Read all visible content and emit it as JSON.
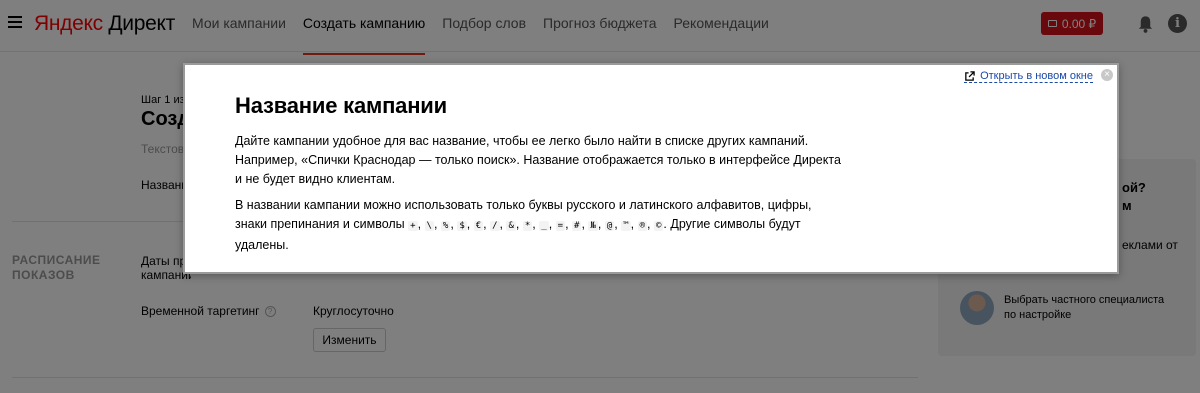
{
  "header": {
    "logo_brand": "Яндекс",
    "logo_product": "Директ",
    "nav": [
      {
        "label": "Мои кампании"
      },
      {
        "label": "Создать кампанию"
      },
      {
        "label": "Подбор слов"
      },
      {
        "label": "Прогноз бюджета"
      },
      {
        "label": "Рекомендации"
      }
    ],
    "balance": "0.00 ₽",
    "info_glyph": "i"
  },
  "background_page": {
    "step": "Шаг 1 из",
    "title": "Созд",
    "subtitle": "Текстово",
    "name_label": "Названи",
    "schedule_section": "РАСПИСАНИЕ\nПОКАЗОВ",
    "dates_label": "Даты пр\nкампании",
    "time_targeting_label": "Временной таргетинг",
    "time_targeting_value": "Круглосуточно",
    "change_button": "Изменить"
  },
  "side_panel": {
    "question": "ой?\nм",
    "text": "еклами от",
    "specialist_text": "Выбрать частного специалиста по настройке"
  },
  "modal": {
    "open_new_window": "Открыть в новом окне",
    "title": "Название кампании",
    "paragraph1": "Дайте кампании удобное для вас название, чтобы ее легко было найти в списке других кампаний. Например, «Спички Краснодар — только поиск». Название отображается только в интерфейсе Директа и не будет видно клиентам.",
    "paragraph2_start": "В названии кампании можно использовать только буквы русского и латинского алфавитов, цифры, знаки препинания и символы",
    "symbols": [
      "+",
      "\\",
      "%",
      "$",
      "€",
      "/",
      "&",
      "*",
      "_",
      "=",
      "#",
      "№",
      "@",
      "™",
      "®",
      "©"
    ],
    "paragraph2_end": ". Другие символы будут удалены."
  },
  "colors": {
    "accent_red": "#e0321f",
    "balance_bg": "#d5131b",
    "link": "#1a4aa8"
  }
}
